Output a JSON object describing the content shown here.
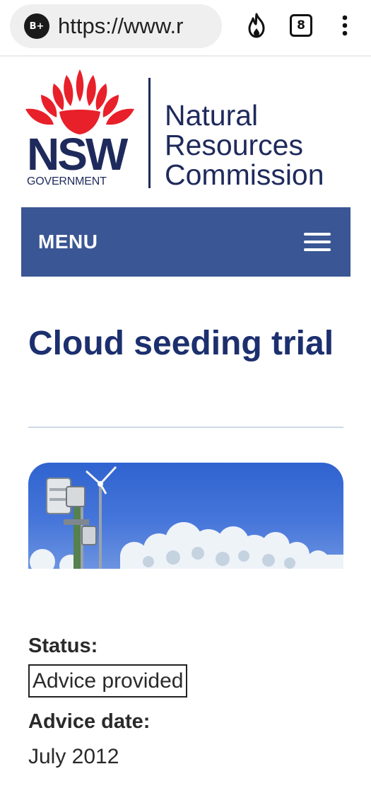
{
  "browser": {
    "site_badge": "B+",
    "url": "https://www.r",
    "tab_count": "8",
    "icons": [
      "site-badge-icon",
      "fire-icon",
      "tab-switcher-icon",
      "more-vert-icon"
    ]
  },
  "header": {
    "logo": {
      "mark": "NSW",
      "sub": "GOVERNMENT",
      "colors": {
        "waratah": "#e8202a",
        "navy": "#1f2a5c"
      }
    },
    "org_name": [
      "Natural",
      "Resources",
      "Commission"
    ]
  },
  "menu": {
    "label": "MENU",
    "icon": "hamburger-icon",
    "background": "#3a5694"
  },
  "page": {
    "title": "Cloud seeding trial",
    "title_color": "#1c2f6e",
    "hero_image": "weather station with snow-covered trees under blue sky"
  },
  "details": {
    "status_label": "Status:",
    "status_value": "Advice provided",
    "advice_date_label": "Advice date:",
    "advice_date_value": "July 2012"
  }
}
